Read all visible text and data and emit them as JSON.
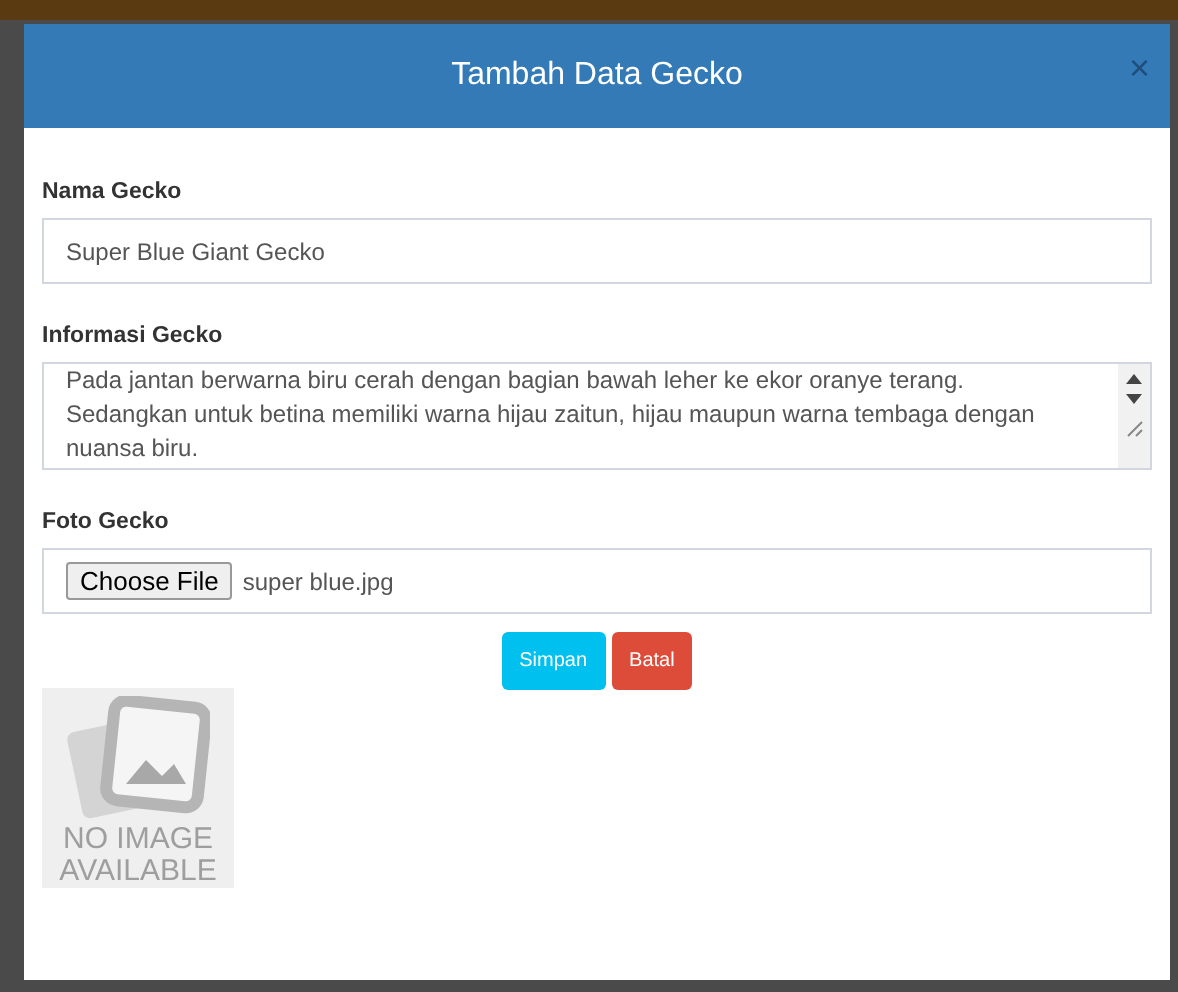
{
  "modal": {
    "title": "Tambah Data Gecko",
    "close": "×"
  },
  "fields": [
    {
      "kind": "text",
      "label": "Nama Gecko",
      "value": "Super Blue Giant Gecko"
    },
    {
      "kind": "textarea",
      "label": "Informasi Gecko",
      "lines": [
        "Pada jantan berwarna biru cerah dengan bagian bawah leher ke ekor oranye terang.",
        "Sedangkan untuk betina memiliki warna hijau zaitun, hijau maupun warna tembaga dengan",
        "nuansa biru."
      ]
    },
    {
      "kind": "file",
      "label": "Foto Gecko",
      "button": "Choose File",
      "value": "super blue.jpg"
    }
  ],
  "buttons": [
    {
      "kind": "primary",
      "label": "Simpan"
    },
    {
      "kind": "danger",
      "label": "Batal"
    }
  ],
  "preview": {
    "lines": [
      "NO IMAGE",
      "AVAILABLE"
    ]
  }
}
